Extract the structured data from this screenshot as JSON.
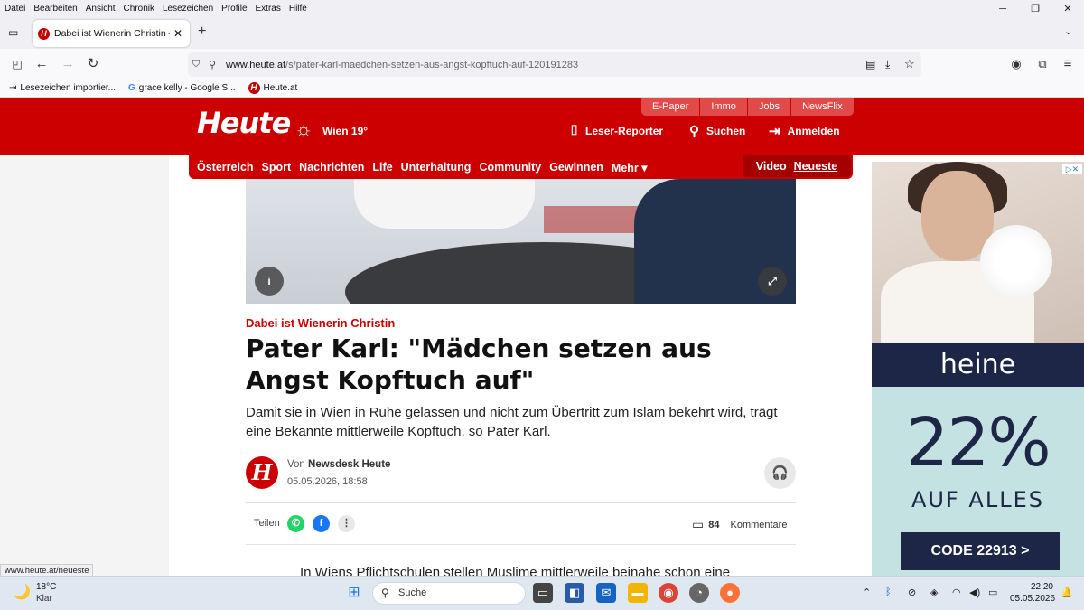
{
  "browser": {
    "menu": [
      "Datei",
      "Bearbeiten",
      "Ansicht",
      "Chronik",
      "Lesezeichen",
      "Profile",
      "Extras",
      "Hilfe"
    ],
    "tab_title": "Dabei ist Wienerin Christin – Pa",
    "url_domain": "www.heute.at",
    "url_path": "/s/pater-karl-maedchen-setzen-aus-angst-kopftuch-auf-120191283",
    "bookmarks": [
      "Lesezeichen importier...",
      "grace kelly - Google S...",
      "Heute.at"
    ],
    "status_url": "www.heute.at/neueste"
  },
  "header": {
    "logo": "Heute",
    "weather": "Wien 19°",
    "top_links": [
      "E-Paper",
      "Immo",
      "Jobs",
      "NewsFlix"
    ],
    "reporter": "Leser-Reporter",
    "search": "Suchen",
    "login": "Anmelden",
    "nav": [
      "Österreich",
      "Sport",
      "Nachrichten",
      "Life",
      "Unterhaltung",
      "Community",
      "Gewinnen",
      "Mehr ▾"
    ],
    "nav_video": "Video",
    "nav_latest": "Neueste"
  },
  "article": {
    "kicker": "Dabei ist Wienerin Christin",
    "headline": "Pater Karl: \"Mädchen setzen aus Angst Kopftuch auf\"",
    "lead": "Damit sie in Wien in Ruhe gelassen und nicht zum Übertritt zum Islam bekehrt wird, trägt eine Bekannte mittlerweile Kopftuch, so Pater Karl.",
    "author_prefix": "Von",
    "author": "Newsdesk Heute",
    "date": "05.05.2026, 18:58",
    "share_label": "Teilen",
    "comment_count": "84",
    "comment_label": "Kommentare",
    "body_start": "In Wiens Pflichtschulen stellen Muslime mittlerweile beinahe schon eine",
    "img_info": "i",
    "img_expand": "⤢",
    "avatar_letter": "H"
  },
  "ad": {
    "brand": "heine",
    "percent": "22%",
    "text": "AUF ALLES",
    "code": "CODE 22913 >"
  },
  "taskbar": {
    "temp": "18°C",
    "condition": "Klar",
    "search": "Suche",
    "time": "22:20",
    "date": "05.05.2026"
  },
  "colors": {
    "brand_red": "#cc0000",
    "ad_navy": "#1d2646",
    "ad_bg": "#c4e2e2"
  }
}
